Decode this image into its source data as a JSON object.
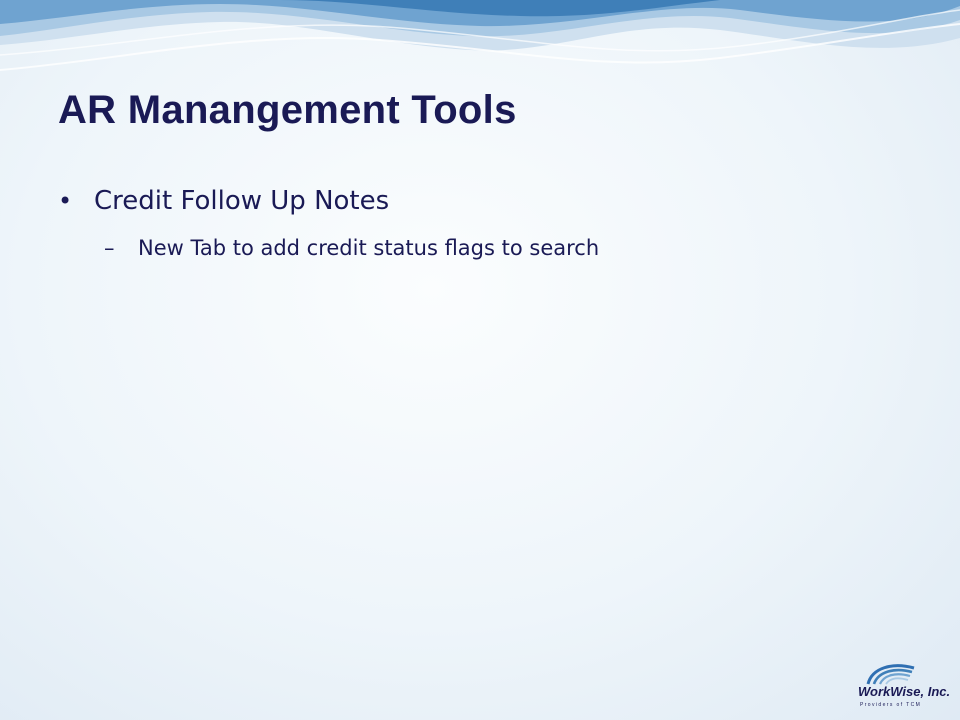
{
  "slide": {
    "title": "AR Manangement Tools",
    "bullets": [
      {
        "text": "Credit Follow Up Notes",
        "sub": [
          "New Tab to add credit status flags to search"
        ]
      }
    ]
  },
  "logo": {
    "name": "WorkWise, Inc.",
    "tagline": "Providers of TCM"
  },
  "colors": {
    "title": "#1a1a55",
    "wave_dark": "#3f7fb8",
    "wave_light": "#a9c9e4"
  },
  "icons": [
    "wave-banner",
    "workwise-logo"
  ]
}
